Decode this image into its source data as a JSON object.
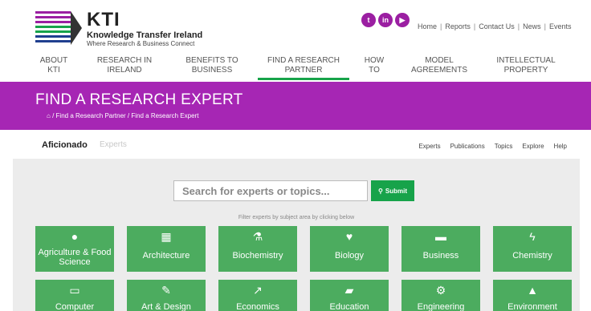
{
  "header": {
    "logo_title": "KTI",
    "logo_name": "Knowledge Transfer Ireland",
    "logo_tagline": "Where Research & Business Connect",
    "social_icons": [
      "twitter-icon",
      "linkedin-icon",
      "youtube-icon"
    ],
    "top_links": [
      "Home",
      "Reports",
      "Contact Us",
      "News",
      "Events"
    ],
    "nav": [
      {
        "line1": "About",
        "line2": "KTI"
      },
      {
        "line1": "Research in",
        "line2": "Ireland"
      },
      {
        "line1": "Benefits to",
        "line2": "Business"
      },
      {
        "line1": "Find a Research",
        "line2": "Partner",
        "active": true
      },
      {
        "line1": "How",
        "line2": "To"
      },
      {
        "line1": "Model",
        "line2": "Agreements"
      },
      {
        "line1": "Intellectual",
        "line2": "Property"
      }
    ]
  },
  "banner": {
    "title": "FIND A RESEARCH EXPERT",
    "breadcrumb": {
      "home_icon": "home-icon",
      "items": [
        "Find a Research Partner",
        "Find a Research Expert"
      ]
    }
  },
  "subbar": {
    "brand": "Aficionado",
    "brand_sub": "Experts",
    "links": [
      "Experts",
      "Publications",
      "Topics",
      "Explore",
      "Help"
    ]
  },
  "search": {
    "placeholder": "Search for experts or topics...",
    "submit_label": "Submit",
    "filter_hint": "Filter experts by subject area by clicking below"
  },
  "subjects": [
    {
      "label": "Agriculture & Food Science",
      "icon": "globe-icon"
    },
    {
      "label": "Architecture",
      "icon": "building-icon"
    },
    {
      "label": "Biochemistry",
      "icon": "flask-icon"
    },
    {
      "label": "Biology",
      "icon": "heartbeat-icon"
    },
    {
      "label": "Business",
      "icon": "briefcase-icon"
    },
    {
      "label": "Chemistry",
      "icon": "bolt-icon"
    },
    {
      "label": "Computer",
      "icon": "laptop-icon"
    },
    {
      "label": "Art & Design",
      "icon": "paintbrush-icon"
    },
    {
      "label": "Economics",
      "icon": "line-chart-icon"
    },
    {
      "label": "Education",
      "icon": "book-icon"
    },
    {
      "label": "Engineering",
      "icon": "cogs-icon"
    },
    {
      "label": "Environment",
      "icon": "tree-icon"
    }
  ],
  "colors": {
    "brand_purple": "#a626b4",
    "accent_green": "#17a34a",
    "tile_green": "#4cac5f"
  }
}
